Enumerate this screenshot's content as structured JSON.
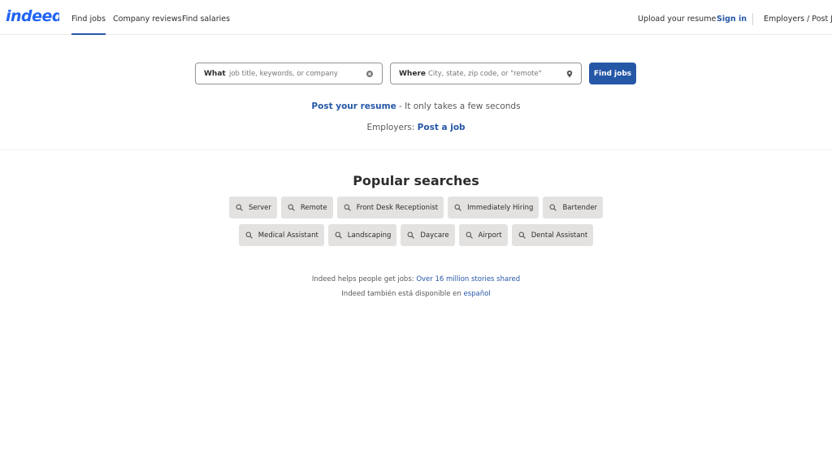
{
  "header": {
    "logo_text": "indeed",
    "nav": {
      "find_jobs": "Find jobs",
      "company_reviews": "Company reviews",
      "find_salaries": "Find salaries"
    },
    "right": {
      "upload_resume": "Upload your resume",
      "sign_in": "Sign in",
      "employers": "Employers / Post Job"
    }
  },
  "search": {
    "what_label": "What",
    "what_placeholder": "job title, keywords, or company",
    "where_label": "Where",
    "where_placeholder": "City, state, zip code, or \"remote\"",
    "button_label": "Find jobs"
  },
  "promo": {
    "resume_link": "Post your resume",
    "resume_text": " - It only takes a few seconds",
    "employers_text": "Employers: ",
    "post_job_link": "Post a job"
  },
  "popular": {
    "title": "Popular searches",
    "row1": [
      "Server",
      "Remote",
      "Front Desk Receptionist",
      "Immediately Hiring",
      "Bartender"
    ],
    "row2": [
      "Medical Assistant",
      "Landscaping",
      "Daycare",
      "Airport",
      "Dental Assistant"
    ]
  },
  "info": {
    "stories_text": "Indeed helps people get jobs: ",
    "stories_link": "Over 16 million stories shared",
    "spanish_text": "Indeed también está disponible en ",
    "spanish_link": "español"
  },
  "colors": {
    "brand_blue": "#2557a7",
    "pill_bg": "#e4e2e0"
  },
  "icons": [
    "search-icon",
    "clear-icon",
    "location-icon"
  ]
}
